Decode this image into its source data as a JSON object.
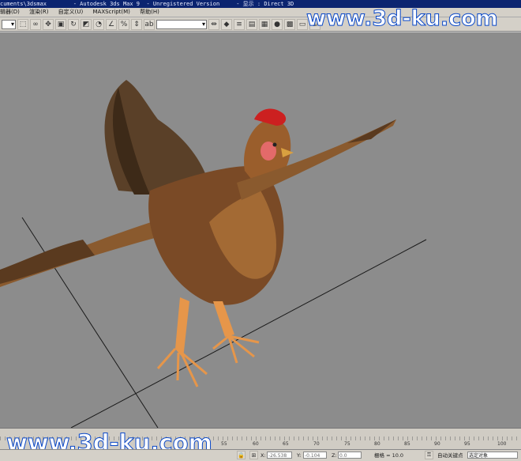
{
  "titlebar": {
    "path": "cuments\\3dsmax",
    "app": "- Autodesk 3ds Max 9  - Unregistered Version",
    "display_label": "- 显示 : Direct 3D"
  },
  "menubar": {
    "items": [
      "辑器(D)",
      "渲染(R)",
      "自定义(U)",
      "MAXScript(M)",
      "帮助(H)"
    ]
  },
  "watermarks": {
    "top": "www.3d-ku.com",
    "bottom": "www.3d-ku.com"
  },
  "timeline": {
    "ticks": [
      "55",
      "60",
      "65",
      "70",
      "75",
      "80",
      "85",
      "90",
      "95",
      "100"
    ]
  },
  "statusbar": {
    "x_label": "X:",
    "x_value": "-26.538",
    "y_label": "Y:",
    "y_value": "-0.104",
    "z_label": "Z:",
    "z_value": "0.0",
    "grid_text": "栅格 = 10.0",
    "autokey_label": "自动关键点",
    "selection_label": "选定对象"
  }
}
